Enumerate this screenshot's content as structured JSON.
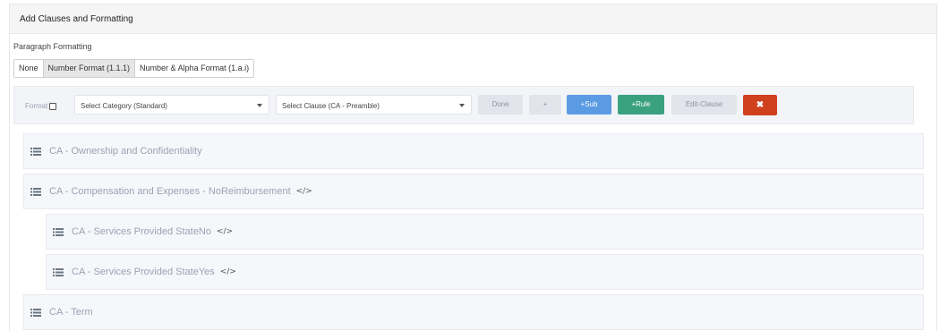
{
  "panel": {
    "title": "Add Clauses and Formatting"
  },
  "paragraph_formatting": {
    "label": "Paragraph Formatting",
    "options": [
      "None",
      "Number Format (1.1.1)",
      "Number & Alpha Format (1.a.i)"
    ],
    "selected": "Number Format (1.1.1)"
  },
  "toolbar": {
    "format_label": "Format",
    "category_select": "Select Category (Standard)",
    "clause_select": "Select Clause (CA - Preamble)",
    "done_label": "Done",
    "plus_label": "+",
    "sub_label": "+Sub",
    "rule_label": "+Rule",
    "edit_label": "Edit-Clause",
    "delete_icon": "times-icon"
  },
  "clauses": [
    {
      "label": "CA - Ownership and Confidentiality",
      "code": ""
    },
    {
      "label": "CA - Compensation and Expenses - NoReimbursement",
      "code": "</>"
    },
    {
      "label": "CA - Services Provided StateNo",
      "code": "</>"
    },
    {
      "label": "CA - Services Provided StateYes",
      "code": "</>"
    },
    {
      "label": "CA - Term",
      "code": ""
    }
  ],
  "colors": {
    "sub_button": "#5a9be3",
    "rule_button": "#3aa17e",
    "delete_button": "#d0401f"
  }
}
